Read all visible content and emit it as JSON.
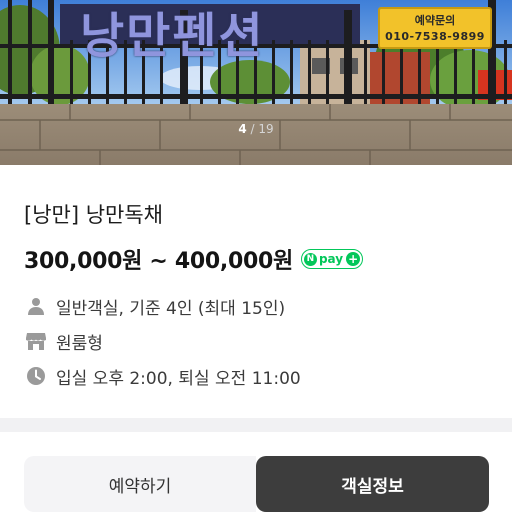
{
  "hero": {
    "sign_text": "낭만펜션",
    "contact_sign": {
      "line1": "예약문의",
      "phone": "010-7538-9899"
    },
    "pager": {
      "current": "4",
      "separator": "/",
      "total": "19"
    }
  },
  "room": {
    "title": "[낭만] 낭만독채",
    "price": "300,000원 ~ 400,000원",
    "npay": {
      "n": "N",
      "pay": "pay",
      "plus": "+"
    },
    "features": [
      {
        "icon": "person-icon",
        "text": "일반객실, 기준 4인 (최대 15인)"
      },
      {
        "icon": "store-icon",
        "text": "원룸형"
      },
      {
        "icon": "clock-icon",
        "text": "입실 오후 2:00, 퇴실 오전 11:00"
      }
    ]
  },
  "buttons": {
    "reserve": "예약하기",
    "room_info": "객실정보"
  },
  "colors": {
    "npay_green": "#03c75a",
    "dark_button": "#3d3d3d",
    "light_button": "#f4f4f6"
  }
}
